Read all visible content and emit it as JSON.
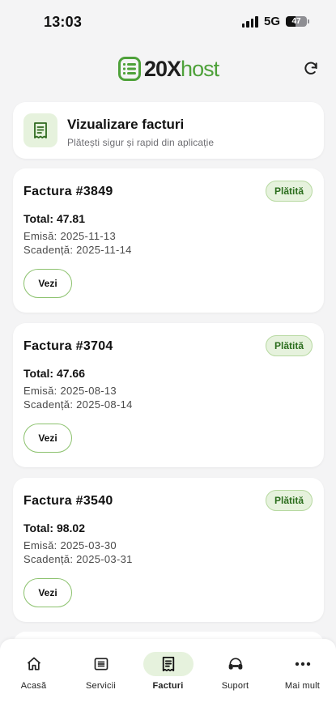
{
  "status_bar": {
    "time": "13:03",
    "network": "5G",
    "battery": "47",
    "battery_level": 0.47
  },
  "header": {
    "logo_text_a": "20X",
    "logo_text_b": "host",
    "brand_color": "#4ea13a"
  },
  "page": {
    "title": "Vizualizare facturi",
    "subtitle": "Plătești sigur și rapid din aplicație"
  },
  "invoices": [
    {
      "title": "Factura #3849",
      "status": "Plătită",
      "total": "Total: 47.81",
      "issued": "Emisă: 2025-11-13",
      "due": "Scadență: 2025-11-14",
      "button": "Vezi"
    },
    {
      "title": "Factura #3704",
      "status": "Plătită",
      "total": "Total: 47.66",
      "issued": "Emisă: 2025-08-13",
      "due": "Scadență: 2025-08-14",
      "button": "Vezi"
    },
    {
      "title": "Factura #3540",
      "status": "Plătită",
      "total": "Total: 98.02",
      "issued": "Emisă: 2025-03-30",
      "due": "Scadență: 2025-03-31",
      "button": "Vezi"
    }
  ],
  "nav": [
    {
      "label": "Acasă",
      "icon": "home-icon",
      "active": false
    },
    {
      "label": "Servicii",
      "icon": "list-icon",
      "active": false
    },
    {
      "label": "Facturi",
      "icon": "invoice-icon",
      "active": true
    },
    {
      "label": "Suport",
      "icon": "headset-icon",
      "active": false
    },
    {
      "label": "Mai mult",
      "icon": "more-icon",
      "active": false
    }
  ]
}
